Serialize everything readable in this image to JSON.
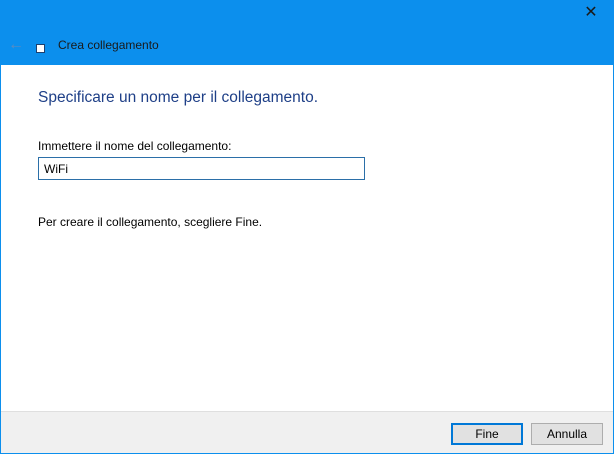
{
  "window": {
    "title": "Crea collegamento",
    "close_glyph": "✕"
  },
  "main": {
    "heading": "Specificare un nome per il collegamento.",
    "name_label": "Immettere il nome del collegamento:",
    "name_value": "WiFi",
    "hint": "Per creare il collegamento, scegliere Fine."
  },
  "footer": {
    "finish_label": "Fine",
    "cancel_label": "Annulla"
  }
}
